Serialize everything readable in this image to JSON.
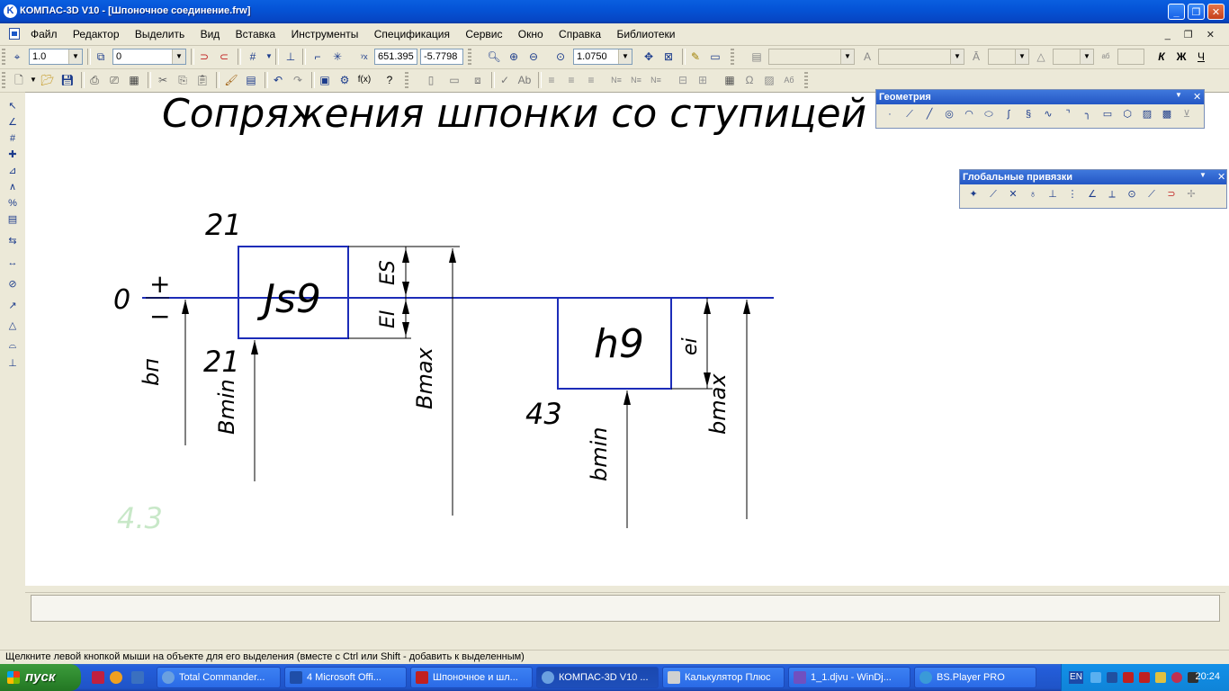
{
  "window": {
    "title": "КОМПАС-3D V10 - [Шпоночное соединение.frw]",
    "app_icon": "K",
    "minimize": "_",
    "maximize": "❐",
    "close": "✕"
  },
  "menu": {
    "items": [
      "Файл",
      "Редактор",
      "Выделить",
      "Вид",
      "Вставка",
      "Инструменты",
      "Спецификация",
      "Сервис",
      "Окно",
      "Справка",
      "Библиотеки"
    ],
    "mdi_controls": "_ ❐ ✕"
  },
  "toolbar1": {
    "step": "1.0",
    "layer": "0",
    "coord_x": "651.395",
    "coord_y": "-5.7798",
    "zoom": "1.0750"
  },
  "drawing": {
    "title": "Сопряжения шпонки со ступицей",
    "hole_field": "Js9",
    "shaft_field": "h9",
    "zero": "0",
    "plus_sign": "+",
    "minus_sign": "−",
    "es_upper": "21",
    "ei_lower": "21",
    "shaft_dev": "43",
    "es_label": "ES",
    "ei_label": "EI",
    "ei_shaft_label": "ei",
    "b_n": "bп",
    "b_min_hole": "Bmin",
    "b_max_hole": "Bmax",
    "b_min_shaft": "bmin",
    "b_max_shaft": "bmax",
    "faint_text": "4.3"
  },
  "panels": {
    "geometry_title": "Геометрия",
    "snaps_title": "Глобальные привязки"
  },
  "status": {
    "hint": "Щелкните левой кнопкой мыши на объекте для его выделения (вместе с Ctrl или Shift - добавить к выделенным)"
  },
  "taskbar": {
    "start": "пуск",
    "tasks": [
      "Total Commander...",
      "4 Microsoft Offi...",
      "Шпоночное и шл...",
      "КОМПАС-3D V10 ...",
      "Калькулятор Плюс",
      "1_1.djvu - WinDj...",
      "BS.Player PRO"
    ],
    "lang": "EN",
    "clock": "20:24"
  },
  "colors": {
    "title_blue": "#0553d6",
    "drawing_blue": "#1c2cb8",
    "start_green": "#2f8a2f",
    "tray_blue": "#1290e8"
  }
}
